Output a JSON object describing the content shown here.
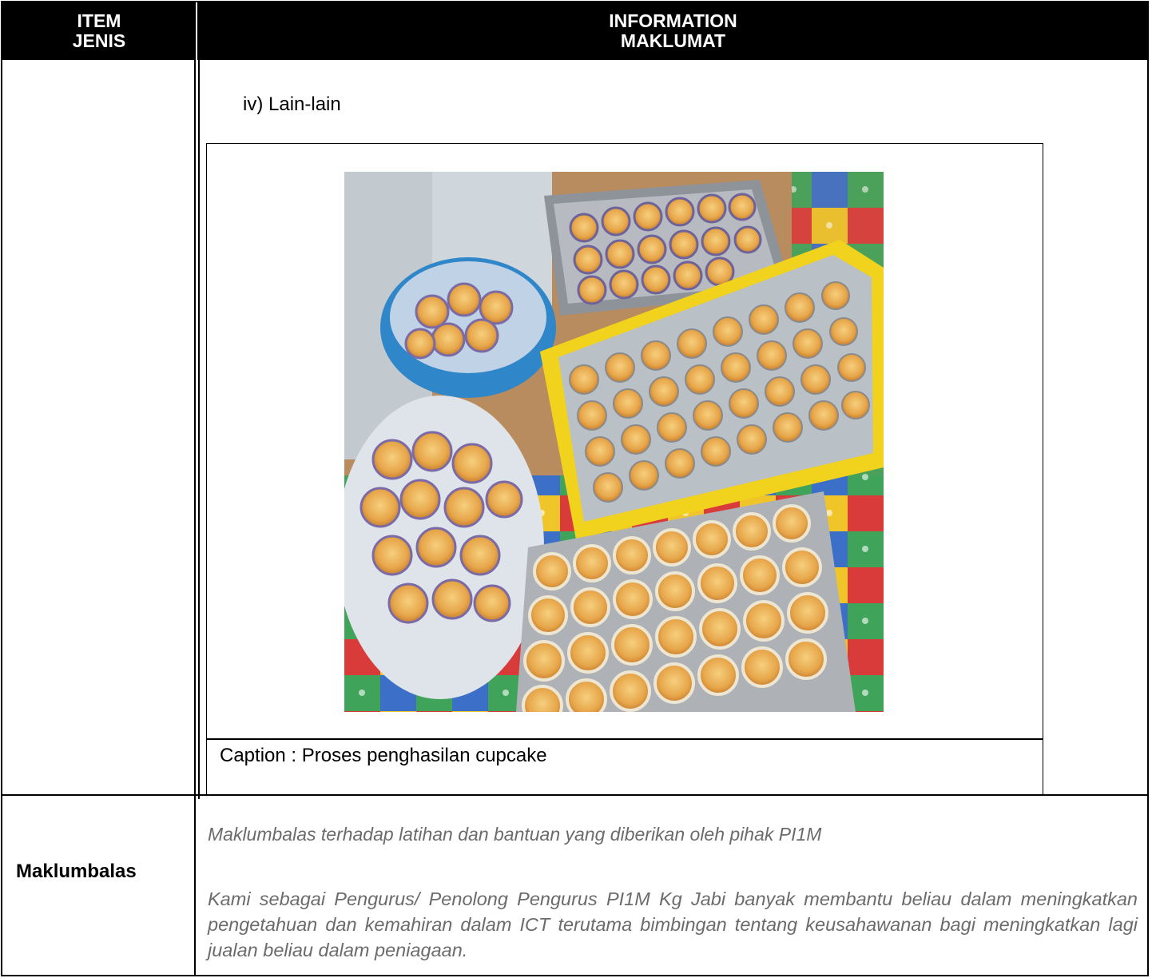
{
  "header": {
    "item_en": "ITEM",
    "item_ms": "JENIS",
    "info_en": "INFORMATION",
    "info_ms": "MAKLUMAT"
  },
  "section": {
    "subheading": "iv)  Lain-lain",
    "caption": "Caption : Proses penghasilan cupcake"
  },
  "feedback": {
    "label": "Maklumbalas",
    "lead": "Maklumbalas terhadap latihan dan bantuan yang diberikan oleh pihak PI1M",
    "body": " Kami sebagai Pengurus/ Penolong Pengurus PI1M Kg Jabi banyak membantu beliau dalam meningkatkan pengetahuan dan kemahiran dalam ICT terutama bimbingan tentang keusahawanan bagi meningkatkan lagi jualan beliau dalam peniagaan."
  }
}
